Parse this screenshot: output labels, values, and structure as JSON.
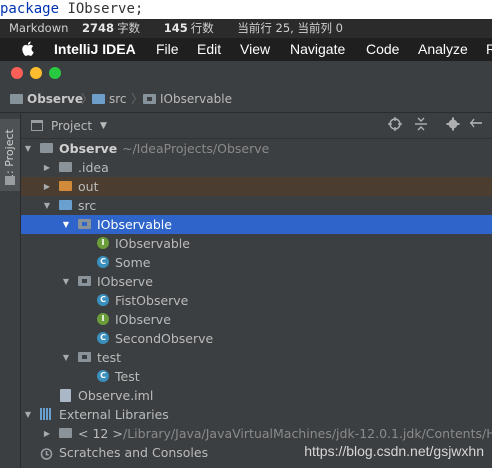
{
  "code": {
    "keyword": "package",
    "identifier": "IObserve",
    "terminator": ";"
  },
  "markdown_status": {
    "mode": "Markdown",
    "chars_count": "2748",
    "chars_unit": "字数",
    "lines_count": "145",
    "lines_unit": "行数",
    "position": "当前行 25, 当前列 0"
  },
  "menubar": {
    "apple": "",
    "app": "IntelliJ IDEA",
    "items": [
      "File",
      "Edit",
      "View",
      "Navigate",
      "Code",
      "Analyze",
      "R"
    ]
  },
  "breadcrumb": [
    "Observe",
    "src",
    "IObservable"
  ],
  "toolstrip": {
    "project_tab": "1: Project"
  },
  "panel": {
    "title": "Project"
  },
  "tree": {
    "root": {
      "name": "Observe",
      "path": "~/IdeaProjects/Observe"
    },
    "idea": ".idea",
    "out": "out",
    "src": "src",
    "pkg_iobservable": "IObservable",
    "iobservable_iface": "IObservable",
    "some_class": "Some",
    "pkg_iobserve": "IObserve",
    "fist_observe": "FistObserve",
    "iobserve_iface": "IObserve",
    "second_observe": "SecondObserve",
    "pkg_test": "test",
    "test_class": "Test",
    "iml": "Observe.iml",
    "external_libraries": "External Libraries",
    "jdk": {
      "name": "< 12 >",
      "path": "/Library/Java/JavaVirtualMachines/jdk-12.0.1.jdk/Contents/H"
    },
    "scratches": "Scratches and Consoles"
  },
  "watermark": "https://blog.csdn.net/gsjwxhn",
  "colors": {
    "selection": "#2f65ca",
    "background": "#3c3f41",
    "out_highlight": "#4c3d31"
  }
}
